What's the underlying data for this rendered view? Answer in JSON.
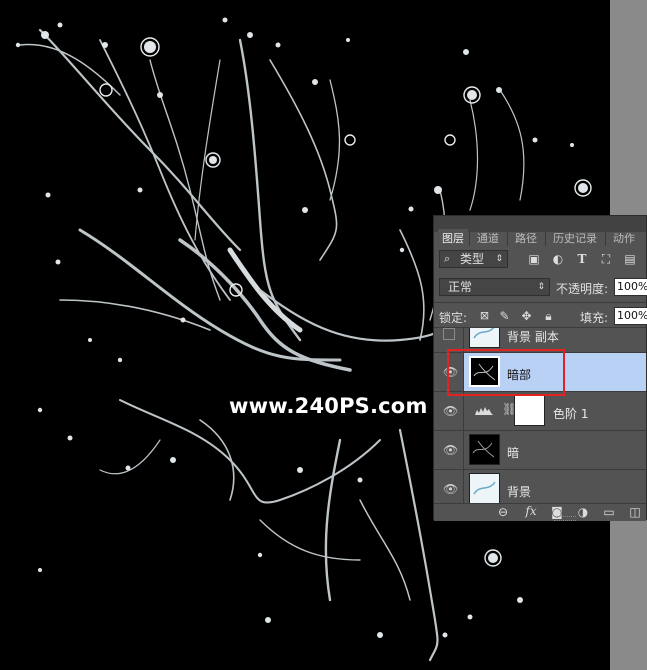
{
  "watermark": "www.240PS.com",
  "colors": {
    "selected_layer": "#b9d1f5",
    "highlight_box": "#e32222",
    "panel_bg": "#535353"
  },
  "panel": {
    "tabs": [
      "图层",
      "通道",
      "路径",
      "历史记录",
      "动作"
    ],
    "active_tab": "图层",
    "filter": {
      "label": "类型",
      "icons": [
        "image-filter-icon",
        "adjustment-filter-icon",
        "type-filter-icon",
        "shape-filter-icon",
        "smart-object-filter-icon"
      ]
    },
    "blend": {
      "mode": "正常",
      "opacity_label": "不透明度:",
      "opacity_value": "100%"
    },
    "lock": {
      "label": "锁定:",
      "fill_label": "填充:",
      "fill_value": "100%"
    },
    "layers": [
      {
        "name": "背景 副本",
        "visible": false,
        "selected": false
      },
      {
        "name": "暗部",
        "visible": true,
        "selected": true
      },
      {
        "name": "色阶 1",
        "visible": true,
        "selected": false,
        "adjustment": true
      },
      {
        "name": "暗",
        "visible": true,
        "selected": false
      },
      {
        "name": "背景",
        "visible": true,
        "selected": false
      }
    ],
    "bottom_icons": [
      "link-icon",
      "fx-icon",
      "mask-icon",
      "adjustment-icon",
      "group-icon",
      "new-layer-icon"
    ]
  }
}
